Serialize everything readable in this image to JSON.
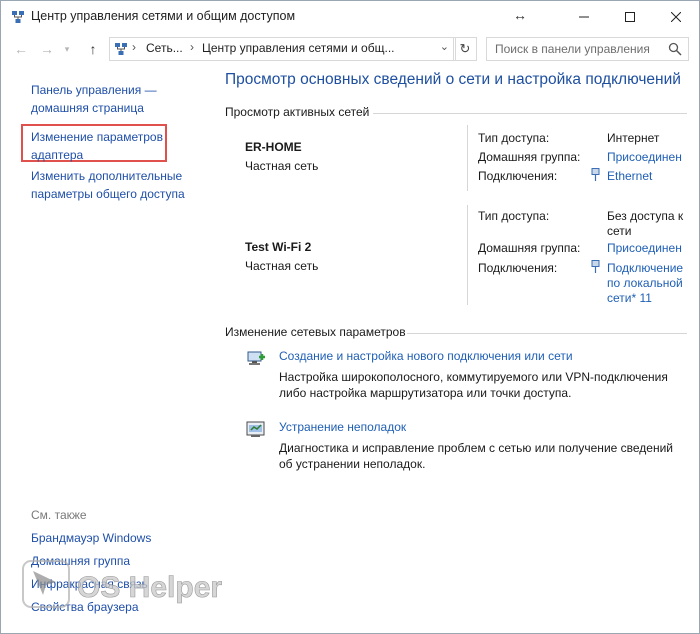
{
  "window": {
    "title": "Центр управления сетями и общим доступом"
  },
  "nav": {
    "breadcrumbs": [
      "Сеть...",
      "Центр управления сетями и общ..."
    ],
    "search_placeholder": "Поиск в панели управления"
  },
  "sidebar": {
    "links": [
      "Панель управления —\nдомашняя страница",
      "Изменение параметров\nадаптера",
      "Изменить дополнительные\nпараметры общего доступа"
    ],
    "see_also_title": "См. также",
    "see_also": [
      "Брандмауэр Windows",
      "Домашняя группа",
      "Инфракрасная связь",
      "Свойства браузера"
    ]
  },
  "main": {
    "title": "Просмотр основных сведений о сети и настройка подключений",
    "active_section": "Просмотр активных сетей",
    "networks": [
      {
        "name": "ER-HOME",
        "type": "Частная сеть",
        "access_label": "Тип доступа:",
        "access_value": "Интернет",
        "homegroup_label": "Домашняя группа:",
        "homegroup_value": "Присоединен",
        "conn_label": "Подключения:",
        "conn_value": "Ethernet"
      },
      {
        "name": "Test Wi-Fi 2",
        "type": "Частная сеть",
        "access_label": "Тип доступа:",
        "access_value": "Без доступа к\nсети",
        "homegroup_label": "Домашняя группа:",
        "homegroup_value": "Присоединен",
        "conn_label": "Подключения:",
        "conn_value": "Подключение\nпо локальной\nсети* 11"
      }
    ],
    "change_section": "Изменение сетевых параметров",
    "tasks": [
      {
        "link": "Создание и настройка нового подключения или сети",
        "desc": "Настройка широкополосного, коммутируемого или VPN-подключения\nлибо настройка маршрутизатора или точки доступа."
      },
      {
        "link": "Устранение неполадок",
        "desc": "Диагностика и исправление проблем с сетью или получение сведений\nоб устранении неполадок."
      }
    ]
  },
  "watermark": {
    "text": "OS Helper"
  },
  "colors": {
    "link": "#1f4fa8",
    "title": "#1e4fa0",
    "highlight": "#e0514e"
  }
}
